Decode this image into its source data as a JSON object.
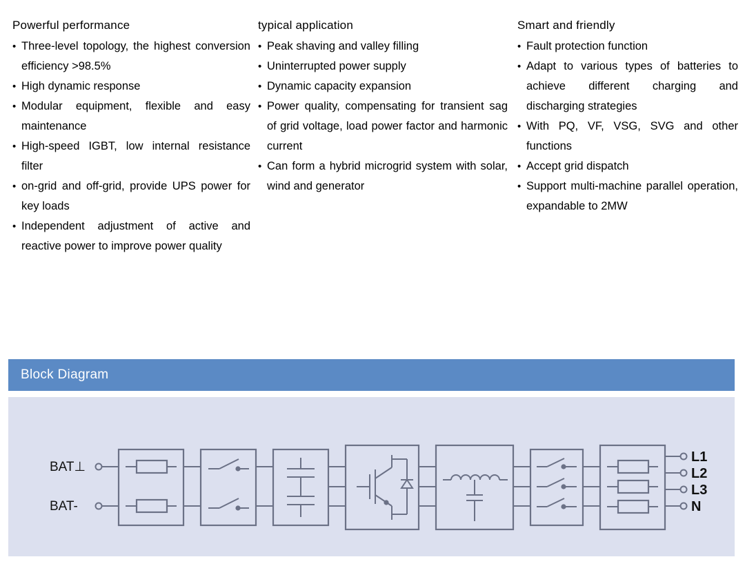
{
  "columns": [
    {
      "title": "Powerful performance",
      "items": [
        "Three-level topology, the highest conversion efficiency >98.5%",
        "High dynamic response",
        "Modular equipment, flexible and easy maintenance",
        "High-speed IGBT, low internal resistance filter",
        "on-grid and off-grid, provide UPS power for key loads",
        "Independent adjustment of active and reactive power to improve power quality"
      ]
    },
    {
      "title": "typical application",
      "items": [
        "Peak shaving and valley filling",
        "Uninterrupted power supply",
        "Dynamic capacity expansion",
        "Power quality, compensating for transient sag of grid voltage, load power factor and harmonic current",
        "Can form a hybrid microgrid system with solar, wind and generator"
      ]
    },
    {
      "title": "Smart and friendly",
      "items": [
        "Fault protection function",
        "Adapt to various types of batteries to achieve different charging and discharging strategies",
        "With PQ, VF, VSG, SVG and other functions",
        "Accept grid dispatch",
        "Support multi-machine parallel operation, expandable to 2MW"
      ]
    }
  ],
  "block_diagram": {
    "header_title": "Block Diagram",
    "header_color": "#5b8ac5",
    "panel_color": "#dce0ef",
    "stroke_color": "#6b7186",
    "input_terminals": [
      {
        "label": "BAT⊥"
      },
      {
        "label": "BAT-"
      }
    ],
    "output_terminals": [
      {
        "label": "L1"
      },
      {
        "label": "L2"
      },
      {
        "label": "L3"
      },
      {
        "label": "N"
      }
    ],
    "stages": [
      {
        "name": "dc-fuse-block",
        "symbol": "fuse"
      },
      {
        "name": "dc-switch-block",
        "symbol": "switch"
      },
      {
        "name": "dc-capacitor-block",
        "symbol": "capacitor"
      },
      {
        "name": "igbt-inverter-block",
        "symbol": "igbt"
      },
      {
        "name": "lc-filter-block",
        "symbol": "inductor-capacitor"
      },
      {
        "name": "ac-switch-block",
        "symbol": "switch"
      },
      {
        "name": "ac-fuse-block",
        "symbol": "fuse"
      }
    ]
  }
}
